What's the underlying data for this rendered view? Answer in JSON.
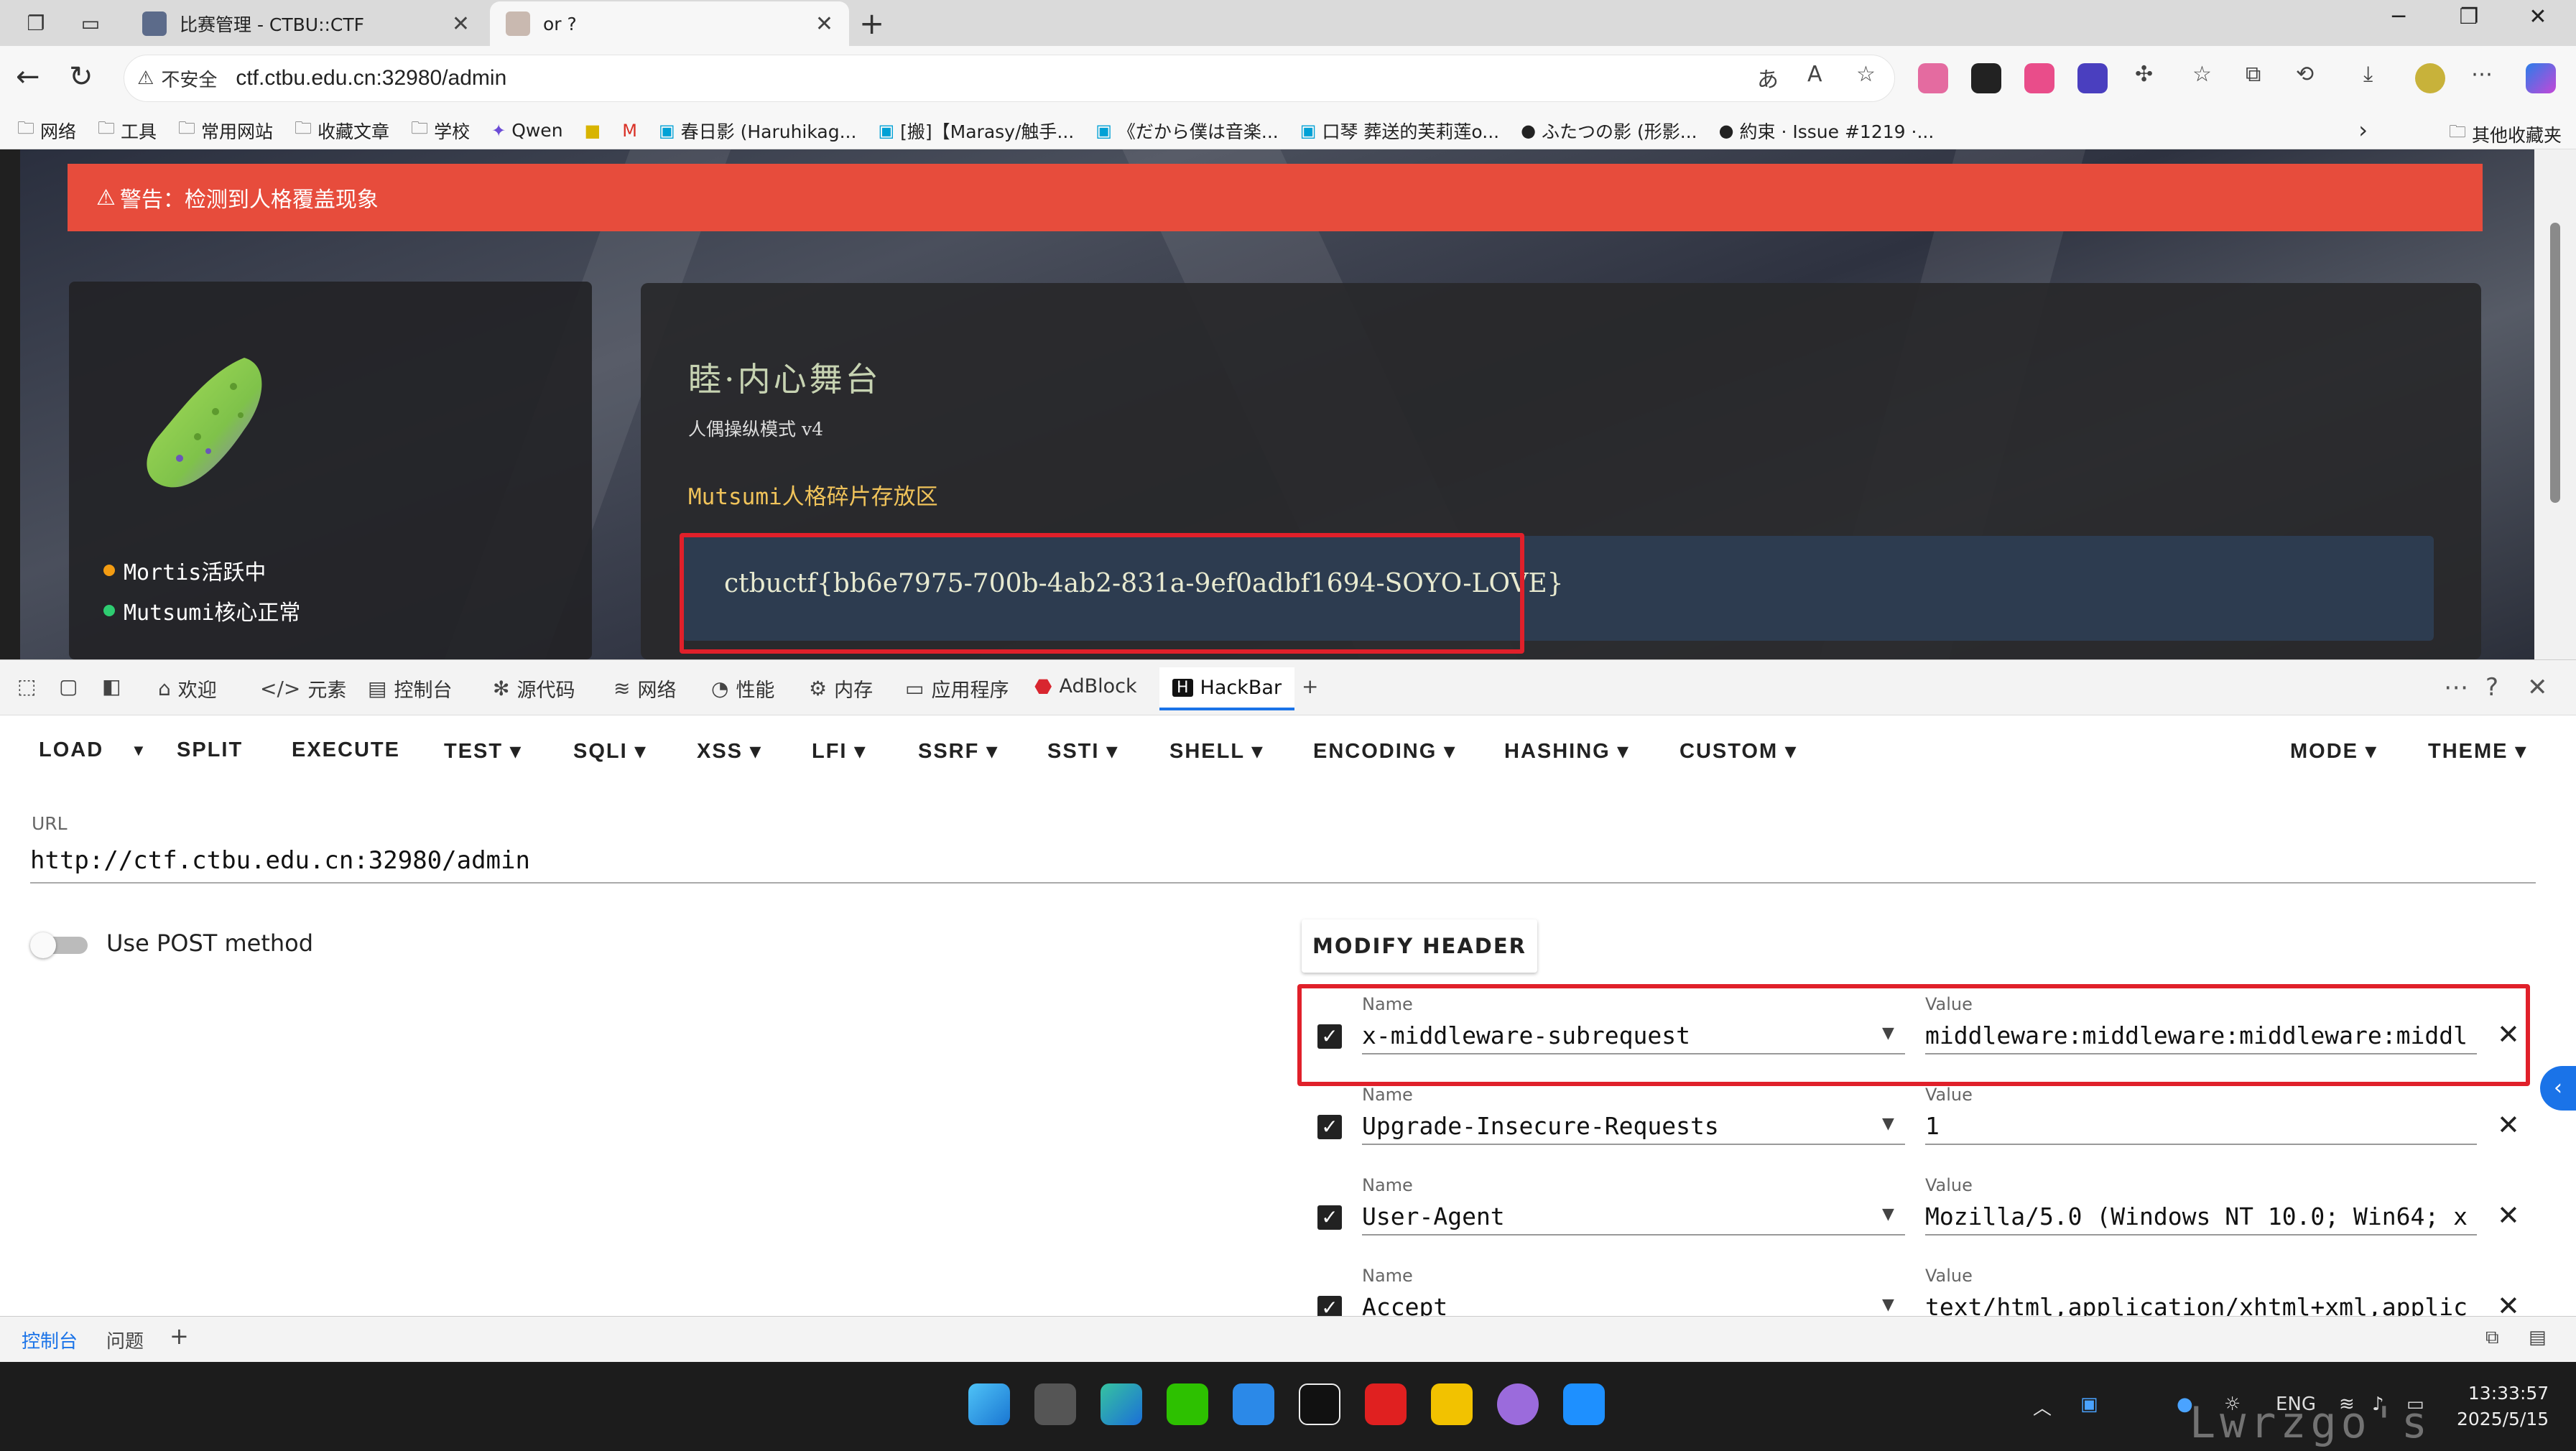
{
  "browser": {
    "tabs": [
      {
        "title": "比赛管理 - CTBU::CTF",
        "active": false
      },
      {
        "title": "or ?",
        "active": true
      }
    ],
    "address": {
      "insecure_label": "不安全",
      "url": "ctf.ctbu.edu.cn:32980/admin"
    },
    "bookmarks": [
      "网络",
      "工具",
      "常用网站",
      "收藏文章",
      "学校",
      "Qwen",
      "春日影 (Haruhikag...",
      "[搬]【Marasy/触手...",
      "《だから僕は音楽...",
      "口琴 葬送的芙莉莲o...",
      "ふたつの影 (形影...",
      "約束 · Issue #1219 ·..."
    ],
    "other_bookmarks": "其他收藏夹"
  },
  "page": {
    "alert": "警告：检测到人格覆盖现象",
    "status": [
      {
        "label": "Mortis活跃中",
        "color": "#f39c12"
      },
      {
        "label": "Mutsumi核心正常",
        "color": "#2ecc71"
      }
    ],
    "stage_title": "睦·内心舞台",
    "stage_subtitle": "人偶操纵模式 v4",
    "fragment_label": "Mutsumi人格碎片存放区",
    "flag": "ctbuctf{bb6e7975-700b-4ab2-831a-9ef0adbf1694-SOYO-LOVE}"
  },
  "devtools": {
    "tabs": [
      "欢迎",
      "元素",
      "控制台",
      "源代码",
      "网络",
      "性能",
      "内存",
      "应用程序",
      "AdBlock",
      "HackBar"
    ],
    "active_tab": "HackBar",
    "drawer_tabs": [
      "控制台",
      "问题"
    ]
  },
  "hackbar": {
    "menu": [
      "LOAD",
      "SPLIT",
      "EXECUTE",
      "TEST",
      "SQLI",
      "XSS",
      "LFI",
      "SSRF",
      "SSTI",
      "SHELL",
      "ENCODING",
      "HASHING",
      "CUSTOM"
    ],
    "mode": "MODE",
    "theme": "THEME",
    "url_label": "URL",
    "url": "http://ctf.ctbu.edu.cn:32980/admin",
    "post_label": "Use POST method",
    "post_enabled": false,
    "modify_header": "MODIFY HEADER",
    "name_label": "Name",
    "value_label": "Value",
    "headers": [
      {
        "name": "x-middleware-subrequest",
        "value": "middleware:middleware:middleware:middl",
        "checked": true
      },
      {
        "name": "Upgrade-Insecure-Requests",
        "value": "1",
        "checked": true
      },
      {
        "name": "User-Agent",
        "value": "Mozilla/5.0 (Windows NT 10.0; Win64; x",
        "checked": true
      },
      {
        "name": "Accept",
        "value": "text/html,application/xhtml+xml,applic",
        "checked": true
      }
    ]
  },
  "taskbar": {
    "lang": "ENG",
    "time": "13:33:57",
    "date": "2025/5/15"
  },
  "watermark": "Lwrzgo's blog"
}
